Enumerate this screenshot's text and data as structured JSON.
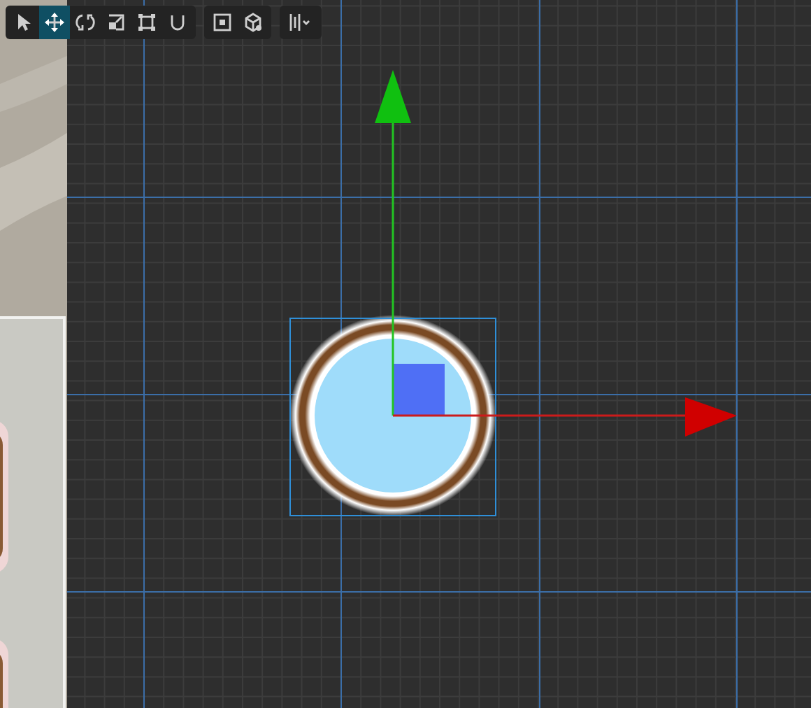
{
  "toolbar": {
    "groups": [
      {
        "tools": [
          {
            "kind": "select",
            "selected": false
          },
          {
            "kind": "move",
            "selected": true
          },
          {
            "kind": "rotate",
            "selected": false
          },
          {
            "kind": "scale",
            "selected": false
          },
          {
            "kind": "rect",
            "selected": false
          },
          {
            "kind": "snap",
            "selected": false
          }
        ]
      },
      {
        "tools": [
          {
            "kind": "pivot",
            "selected": false
          },
          {
            "kind": "local",
            "selected": false
          }
        ]
      },
      {
        "tools": [
          {
            "kind": "align",
            "selected": false
          }
        ]
      }
    ]
  }
}
